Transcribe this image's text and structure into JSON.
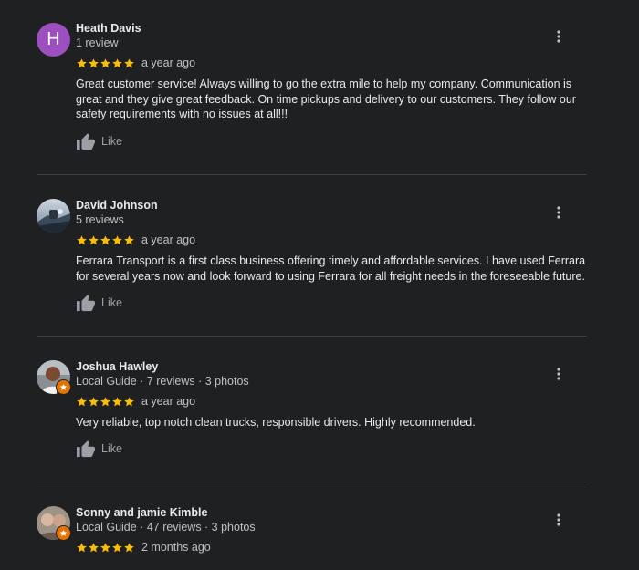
{
  "reviews": [
    {
      "name": "Heath Davis",
      "avatar_letter": "H",
      "meta": "1 review",
      "rating": 5,
      "date": "a year ago",
      "text": "Great customer service! Always willing to go the extra mile to help my company. Communication is great and they give great feedback. On time pickups and delivery to our customers. They follow our safety requirements with no issues at all!!!",
      "like_label": "Like"
    },
    {
      "name": "David Johnson",
      "meta": "5 reviews",
      "rating": 5,
      "date": "a year ago",
      "text": "Ferrara Transport is a first class business offering timely and affordable services.  I have used Ferrara for several years now and look forward to using Ferrara for all freight needs in the foreseeable future.",
      "like_label": "Like"
    },
    {
      "name": "Joshua Hawley",
      "meta": "Local Guide · 7 reviews · 3 photos",
      "rating": 5,
      "date": "a year ago",
      "text": "Very reliable, top notch clean trucks, responsible drivers. Highly recommended.",
      "like_label": "Like"
    },
    {
      "name": "Sonny and jamie Kimble",
      "meta": "Local Guide · 47 reviews · 3 photos",
      "rating": 5,
      "date": "2 months ago"
    }
  ],
  "colors": {
    "background": "#1f2022",
    "star": "#fbbc04",
    "avatar_h": "#9c4fbf",
    "local_guide_badge": "#e37400",
    "divider": "#3c4043"
  },
  "icons": {
    "more": "more-vert-icon",
    "like": "thumbs-up-icon",
    "star": "star-icon"
  }
}
